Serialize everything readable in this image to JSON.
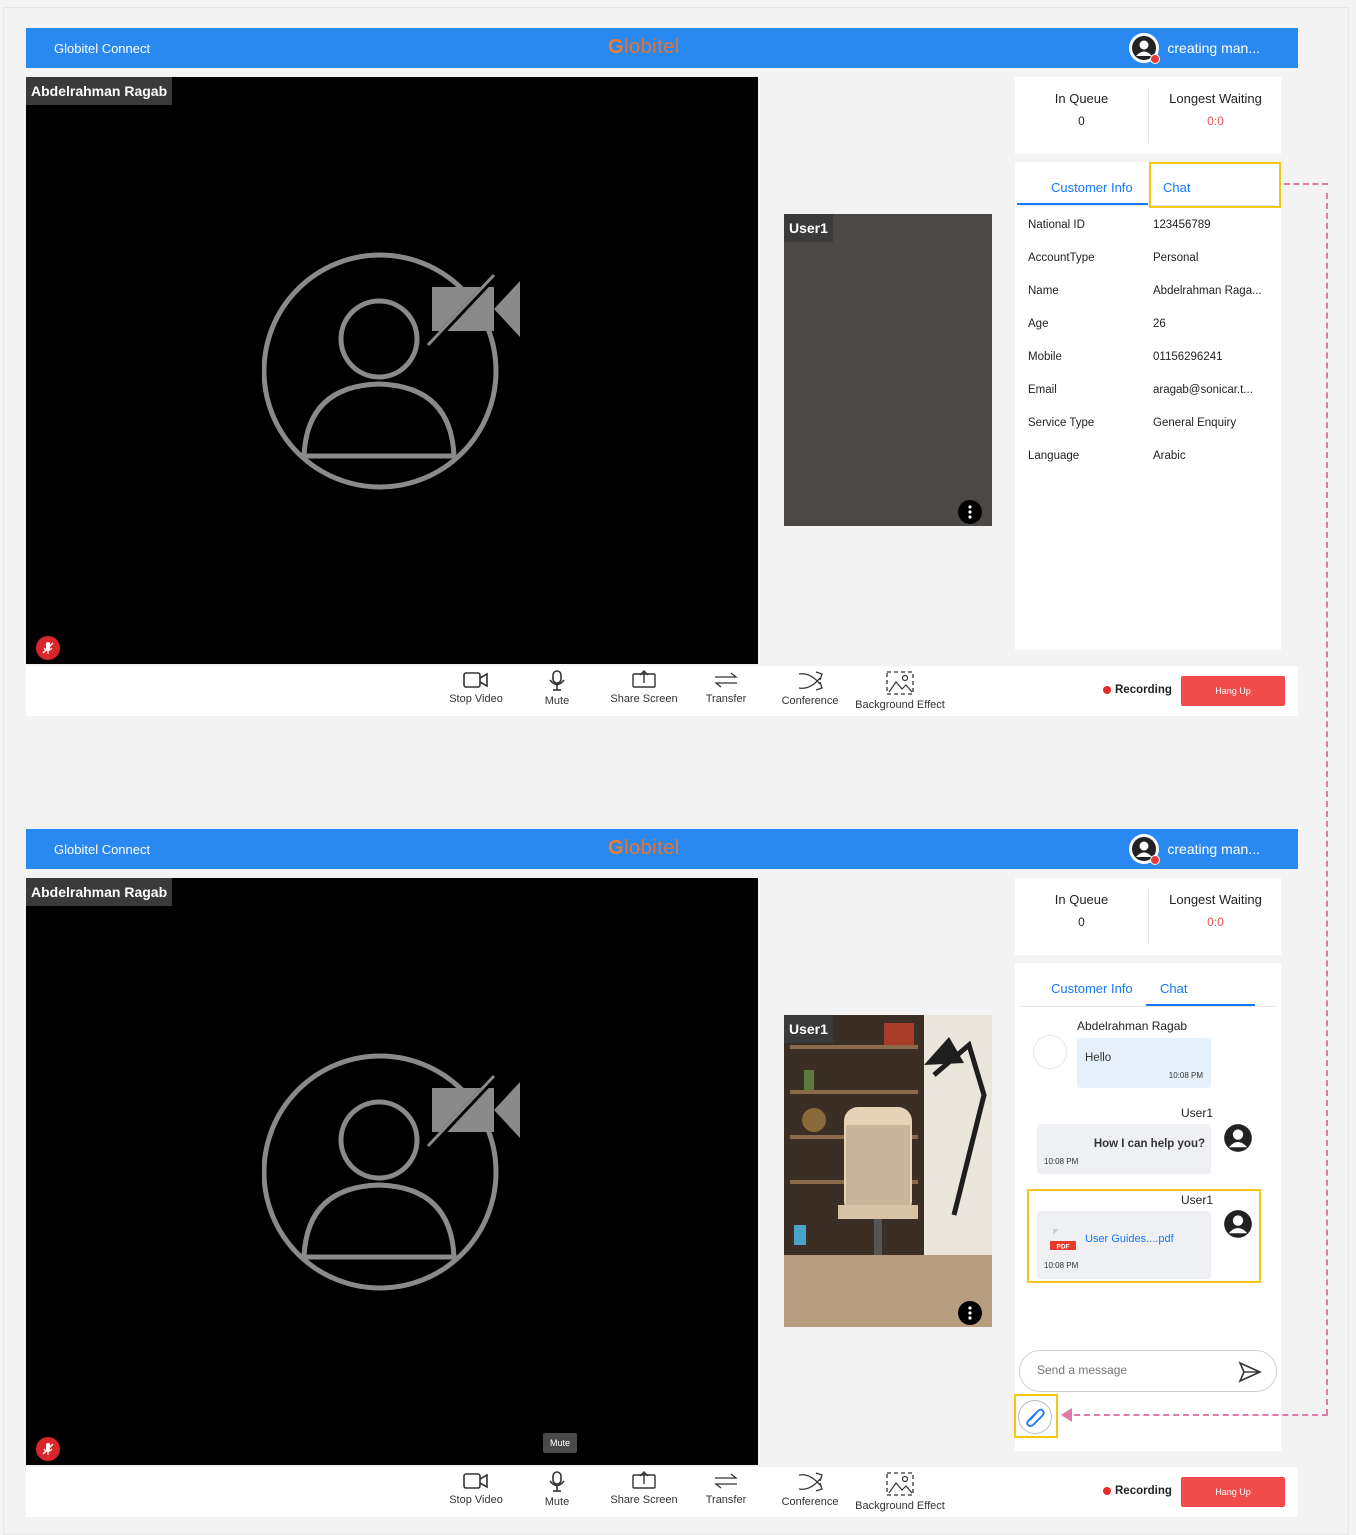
{
  "app": {
    "name": "Globitel Connect",
    "logo_text": "lobitel",
    "logo_glyph": "G",
    "user": "creating man..."
  },
  "main_video": {
    "name": "Abdelrahman Ragab"
  },
  "thumb": {
    "name": "User1"
  },
  "queue": {
    "in_queue_label": "In Queue",
    "in_queue_value": "0",
    "longest_label": "Longest Waiting",
    "longest_value": "0:0"
  },
  "tabs": {
    "customer_info": "Customer Info",
    "chat": "Chat"
  },
  "customer_info": [
    {
      "label": "National ID",
      "value": "123456789"
    },
    {
      "label": "AccountType",
      "value": "Personal"
    },
    {
      "label": "Name",
      "value": "Abdelrahman Raga..."
    },
    {
      "label": "Age",
      "value": "26"
    },
    {
      "label": "Mobile",
      "value": "01156296241"
    },
    {
      "label": "Email",
      "value": "aragab@sonicar.t..."
    },
    {
      "label": "Service Type",
      "value": "General Enquiry"
    },
    {
      "label": "Language",
      "value": "Arabic"
    }
  ],
  "chat": {
    "messages": [
      {
        "sender": "Abdelrahman Ragab",
        "text": "Hello",
        "time": "10:08 PM"
      },
      {
        "sender": "User1",
        "text": "How I can help you?",
        "time": "10:08 PM"
      },
      {
        "sender": "User1",
        "file": "User Guides....pdf",
        "time": "10:08 PM",
        "file_badge": "PDF"
      }
    ],
    "input_placeholder": "Send a message"
  },
  "toolbar": {
    "stop_video": "Stop Video",
    "mute": "Mute",
    "share_screen": "Share Screen",
    "transfer": "Transfer",
    "conference": "Conference",
    "background_effect": "Background Effect",
    "recording": "Recording",
    "hang_up": "Hang Up"
  },
  "tooltip": "Mute",
  "colors": {
    "topbar": "#2989f0",
    "accent": "#1677ff",
    "hangup": "#f24b4b",
    "highlight": "#f5c518",
    "annotation": "#e07aa8"
  }
}
